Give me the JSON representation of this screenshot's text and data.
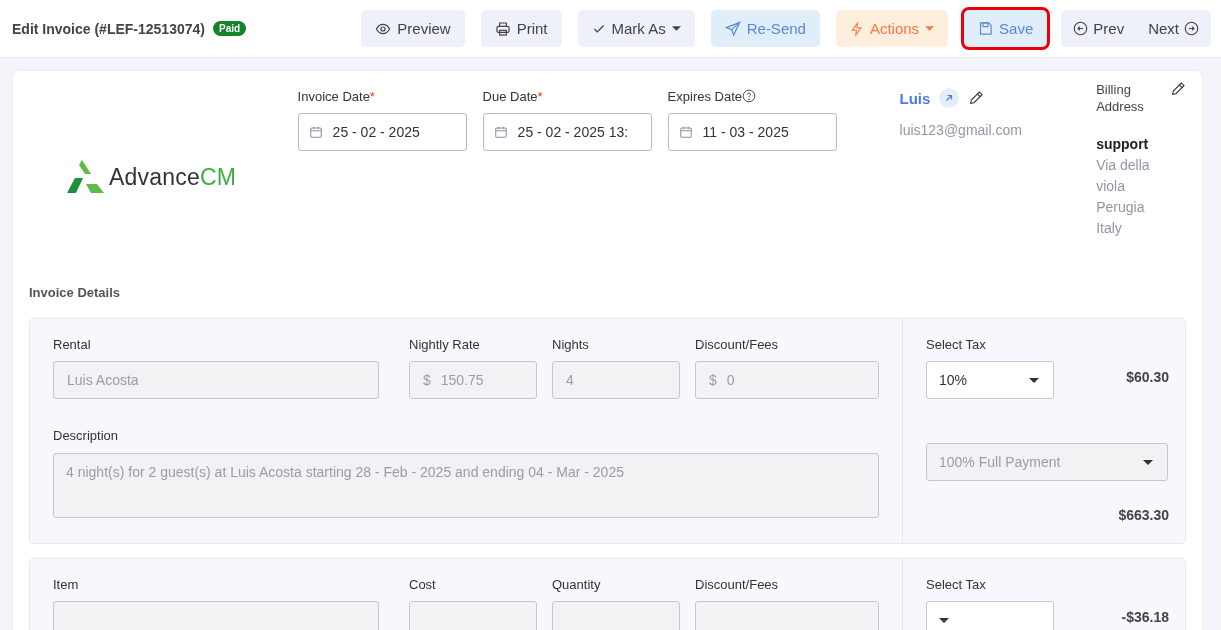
{
  "header": {
    "title": "Edit Invoice (#LEF-12513074)",
    "badge": "Paid"
  },
  "buttons": [
    {
      "label": "Preview",
      "kind": "default",
      "caret": false,
      "highlighted": false
    },
    {
      "label": "Print",
      "kind": "default",
      "caret": false,
      "highlighted": false
    },
    {
      "label": "Mark As",
      "kind": "default",
      "caret": true,
      "highlighted": false
    },
    {
      "label": "Re-Send",
      "kind": "info",
      "caret": false,
      "highlighted": false
    },
    {
      "label": "Actions",
      "kind": "warning",
      "caret": true,
      "highlighted": false
    },
    {
      "label": "Save",
      "kind": "info",
      "caret": false,
      "highlighted": true
    }
  ],
  "nav": {
    "prev": "Prev",
    "next": "Next"
  },
  "logo": {
    "text": "Advance",
    "accent": "CM"
  },
  "dates": [
    {
      "label": "Invoice Date",
      "required_mark": "*",
      "help": false,
      "value": "25 - 02 - 2025"
    },
    {
      "label": "Due Date",
      "required_mark": "*",
      "help": false,
      "value": "25 - 02 - 2025 13:"
    },
    {
      "label": "Expires Date",
      "help": true,
      "value": "11 - 03 - 2025"
    }
  ],
  "customer": {
    "name": "Luis",
    "email": "luis123@gmail.com"
  },
  "billing": {
    "title": "Billing Address",
    "name": "support",
    "lines": [
      "Via della",
      "viola",
      "Perugia",
      "Italy"
    ]
  },
  "section_title": "Invoice Details",
  "line_items": [
    {
      "fields": [
        {
          "label": "Rental",
          "value": "Luis Acosta"
        },
        {
          "label": "Nightly Rate",
          "prefix": "$",
          "value": "150.75"
        },
        {
          "label": "Nights",
          "value": "4"
        },
        {
          "label": "Discount/Fees",
          "prefix": "$",
          "value": "0"
        }
      ],
      "description_label": "Description",
      "description": "4 night(s) for 2 guest(s) at Luis Acosta starting 28 - Feb - 2025 and ending 04 - Mar - 2025",
      "tax_label": "Select Tax",
      "tax_value": "10%",
      "amount": "$60.30",
      "payment": "100% Full Payment",
      "total": "$663.30"
    },
    {
      "fields": [
        {
          "label": "Item"
        },
        {
          "label": "Cost"
        },
        {
          "label": "Quantity"
        },
        {
          "label": "Discount/Fees"
        }
      ],
      "tax_label": "Select Tax",
      "amount": "-$36.18"
    }
  ]
}
